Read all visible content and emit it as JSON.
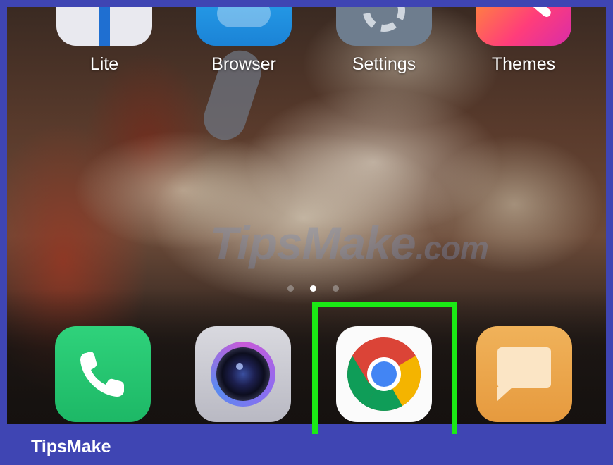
{
  "top_apps": [
    {
      "label": "Lite",
      "icon": "lite-app-icon"
    },
    {
      "label": "Browser",
      "icon": "browser-icon"
    },
    {
      "label": "Settings",
      "icon": "settings-gear-icon"
    },
    {
      "label": "Themes",
      "icon": "themes-brush-icon"
    }
  ],
  "dock_apps": [
    {
      "name": "Phone",
      "icon": "phone-icon"
    },
    {
      "name": "Camera",
      "icon": "camera-icon"
    },
    {
      "name": "Chrome",
      "icon": "chrome-icon",
      "highlighted": true
    },
    {
      "name": "Messages",
      "icon": "messages-icon"
    }
  ],
  "page_indicator": {
    "pages": 3,
    "active_page": 2
  },
  "watermark": {
    "text_main": "TipsMake",
    "text_suffix": ".com"
  },
  "footer": {
    "brand": "TipsMake"
  },
  "colors": {
    "frame": "#3f45b3",
    "highlight": "#1bea15"
  }
}
